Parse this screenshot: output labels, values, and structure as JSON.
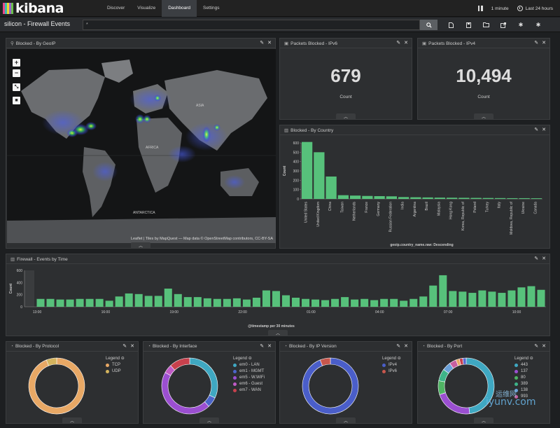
{
  "app": {
    "logo_text": "kibana",
    "logo_colors": [
      "#e8478b",
      "#3ebeb0",
      "#f3d52f",
      "#9b66c9",
      "#6abf4b"
    ]
  },
  "nav": [
    {
      "label": "Discover",
      "active": false
    },
    {
      "label": "Visualize",
      "active": false
    },
    {
      "label": "Dashboard",
      "active": true
    },
    {
      "label": "Settings",
      "active": false
    }
  ],
  "top_right": {
    "refresh": "1 minute",
    "time_range": "Last 24 hours"
  },
  "searchbar": {
    "dashboard_title": "silicon - Firewall Events",
    "query": "*"
  },
  "panels": {
    "geoip": {
      "title": "Blocked - By GeoIP",
      "attribution": "Leaflet | Tiles by MapQuest — Map data © OpenStreetMap contributors, CC-BY-SA",
      "labels": {
        "asia": "ASIA",
        "africa": "AFRICA",
        "antarctica": "ANTARCTICA"
      }
    },
    "ipv6": {
      "title": "Packets Blocked - IPv6",
      "value": "679",
      "label": "Count"
    },
    "ipv4": {
      "title": "Packets Blocked - IPv4",
      "value": "10,494",
      "label": "Count"
    },
    "country": {
      "title": "Blocked - By Country",
      "xlabel": "geoip.country_name.raw: Descending",
      "ylabel": "Count"
    },
    "timeline": {
      "title": "Firewall - Events by Time",
      "xlabel": "@timestamp per 30 minutes",
      "ylabel": "Count"
    },
    "protocol": {
      "title": "Blocked - By Protocol",
      "legend_title": "Legend"
    },
    "interface": {
      "title": "Blocked - By Interface",
      "legend_title": "Legend"
    },
    "ipversion": {
      "title": "Blocked - By IP Version",
      "legend_title": "Legend"
    },
    "port": {
      "title": "Blocked - By Port",
      "legend_title": "Legend"
    }
  },
  "chart_data": [
    {
      "type": "bar",
      "id": "country",
      "title": "Blocked - By Country",
      "xlabel": "geoip.country_name.raw: Descending",
      "ylabel": "Count",
      "ylim": [
        0,
        600
      ],
      "yticks": [
        0,
        100,
        200,
        300,
        400,
        500,
        600
      ],
      "categories": [
        "United States",
        "United Kingdom",
        "China",
        "Taiwan",
        "Netherlands",
        "France",
        "Germany",
        "Russian Federation",
        "India",
        "Argentina",
        "Brazil",
        "Malaysia",
        "Hong Kong",
        "Korea, Republic of",
        "Poland",
        "Turkey",
        "Italy",
        "Moldova, Republic of",
        "Ukraine",
        "Canada"
      ],
      "values": [
        610,
        500,
        240,
        40,
        36,
        32,
        30,
        28,
        20,
        18,
        16,
        14,
        13,
        12,
        11,
        10,
        9,
        8,
        8,
        7
      ],
      "color": "#57c17b"
    },
    {
      "type": "bar",
      "id": "timeline",
      "title": "Firewall - Events by Time",
      "xlabel": "@timestamp per 30 minutes",
      "ylabel": "Count",
      "ylim": [
        0,
        600
      ],
      "yticks": [
        0,
        200,
        400,
        600
      ],
      "xtick_labels": [
        "13:00",
        "16:00",
        "19:00",
        "22:00",
        "01:00",
        "04:00",
        "07:00",
        "10:00"
      ],
      "values": [
        130,
        130,
        120,
        120,
        130,
        130,
        130,
        100,
        170,
        220,
        210,
        180,
        180,
        300,
        210,
        160,
        160,
        140,
        130,
        130,
        140,
        120,
        150,
        270,
        260,
        190,
        150,
        130,
        120,
        110,
        130,
        160,
        120,
        130,
        110,
        130,
        130,
        100,
        130,
        170,
        350,
        520,
        260,
        250,
        230,
        270,
        250,
        230,
        270,
        320,
        340,
        280
      ],
      "color": "#57c17b"
    },
    {
      "type": "pie",
      "id": "protocol",
      "slices": [
        {
          "label": "TCP",
          "value": 94,
          "color": "#e8a865"
        },
        {
          "label": "UDP",
          "value": 6,
          "color": "#d4b45e"
        }
      ]
    },
    {
      "type": "pie",
      "id": "interface",
      "slices": [
        {
          "label": "em0 - LAN",
          "value": 32,
          "color": "#3fa8c2"
        },
        {
          "label": "em1 - MGMT",
          "value": 6,
          "color": "#4b65c9"
        },
        {
          "label": "em5 - W.WiFi",
          "value": 45,
          "color": "#9b4fd1"
        },
        {
          "label": "em6 - Guest",
          "value": 5,
          "color": "#c05bc6"
        },
        {
          "label": "em7 - WAN",
          "value": 12,
          "color": "#c8414d"
        }
      ]
    },
    {
      "type": "pie",
      "id": "ipversion",
      "slices": [
        {
          "label": "IPv4",
          "value": 94,
          "color": "#4a5ec9"
        },
        {
          "label": "IPv6",
          "value": 6,
          "color": "#c8574d"
        }
      ]
    },
    {
      "type": "pie",
      "id": "port",
      "slices": [
        {
          "label": "443",
          "value": 48,
          "color": "#3fa8c2"
        },
        {
          "label": "137",
          "value": 22,
          "color": "#9b4fd1"
        },
        {
          "label": "80",
          "value": 8,
          "color": "#4fb463"
        },
        {
          "label": "389",
          "value": 7,
          "color": "#3eb489"
        },
        {
          "label": "138",
          "value": 5,
          "color": "#6aa0d8"
        },
        {
          "label": "993",
          "value": 4,
          "color": "#c85fa0"
        },
        {
          "label": "",
          "value": 2,
          "color": "#e8a865"
        },
        {
          "label": "",
          "value": 2,
          "color": "#c8414d"
        },
        {
          "label": "",
          "value": 2,
          "color": "#5a6ad0"
        }
      ]
    }
  ],
  "watermark": {
    "text": "iyunv.com",
    "sub": "运维网"
  }
}
